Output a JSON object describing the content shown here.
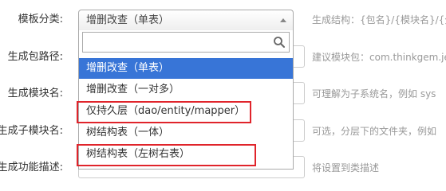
{
  "form": {
    "rows": [
      {
        "label": "模板分类:",
        "help": "生成结构：{包名}/{模块名}/{分层"
      },
      {
        "label": "生成包路径:",
        "help": "建议模块包：com.thinkgem.je"
      },
      {
        "label": "生成模块名:",
        "help": "可理解为子系统名，例如 sys"
      },
      {
        "label": "生成子模块名:",
        "help": "可选，分层下的文件夹，例如"
      },
      {
        "label": "生成功能描述:",
        "help": "将设置到类描述"
      }
    ]
  },
  "select": {
    "value": "增删改查（单表）",
    "search_placeholder": "",
    "options": [
      "增删改查（单表）",
      "增删改查（一对多）",
      "仅持久层（dao/entity/mapper）",
      "树结构表（一体）",
      "树结构表（左树右表）"
    ],
    "selected_index": 0,
    "highlighted_indices": [
      2,
      4
    ]
  },
  "colors": {
    "selected_bg": "#3875d7",
    "highlight_border": "#e0242b"
  },
  "icons": {
    "select_arrow": "chevron-up-icon",
    "search": "search-icon"
  }
}
